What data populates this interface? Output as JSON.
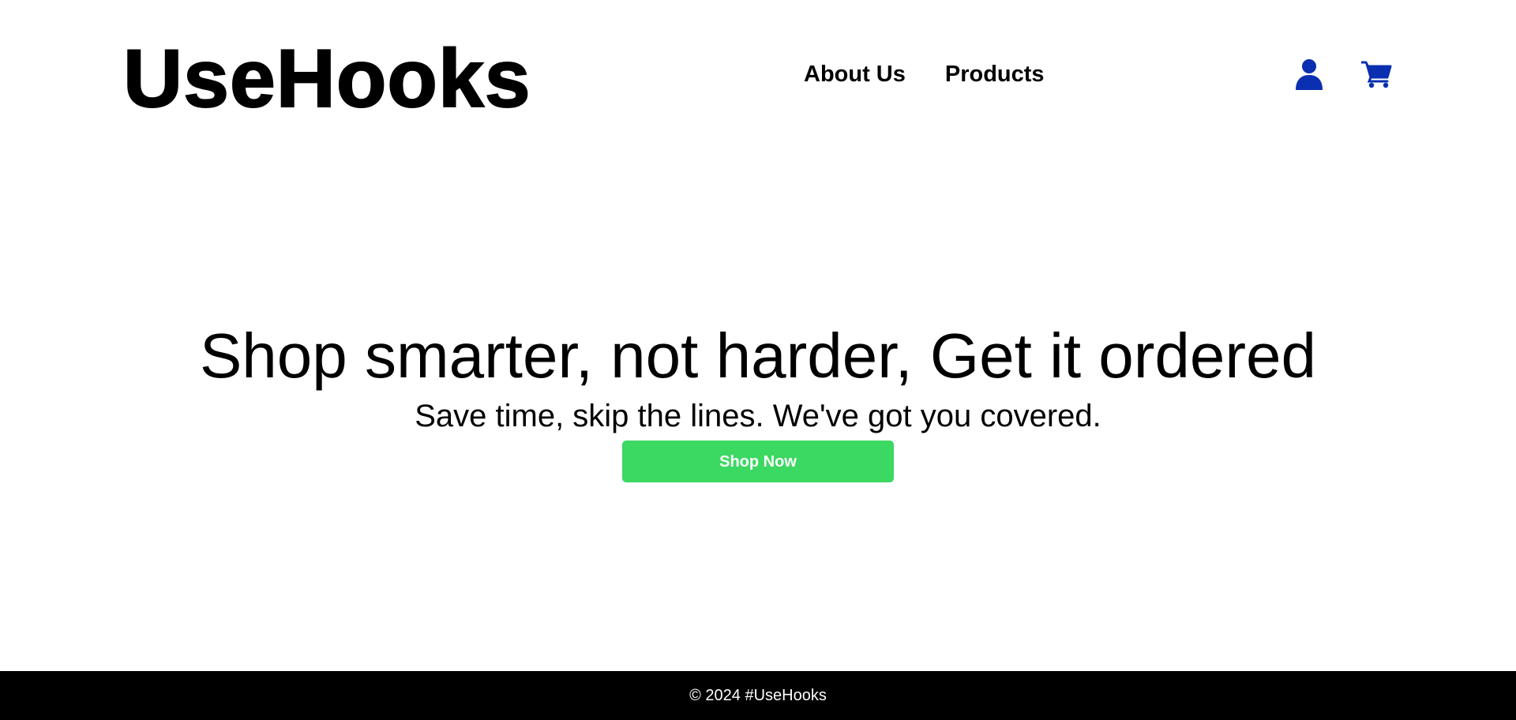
{
  "brand": {
    "logo_text": "UseHooks"
  },
  "nav": {
    "items": [
      {
        "label": "About Us"
      },
      {
        "label": "Products"
      }
    ]
  },
  "header_icons": {
    "user_icon": "user-icon",
    "cart_icon": "cart-icon",
    "color": "#0a2fb0"
  },
  "hero": {
    "title": "Shop smarter, not harder, Get it ordered",
    "subtitle": "Save time, skip the lines. We've got you covered.",
    "cta_label": "Shop Now",
    "cta_color": "#3bd862"
  },
  "footer": {
    "text": "© 2024 #UseHooks"
  }
}
